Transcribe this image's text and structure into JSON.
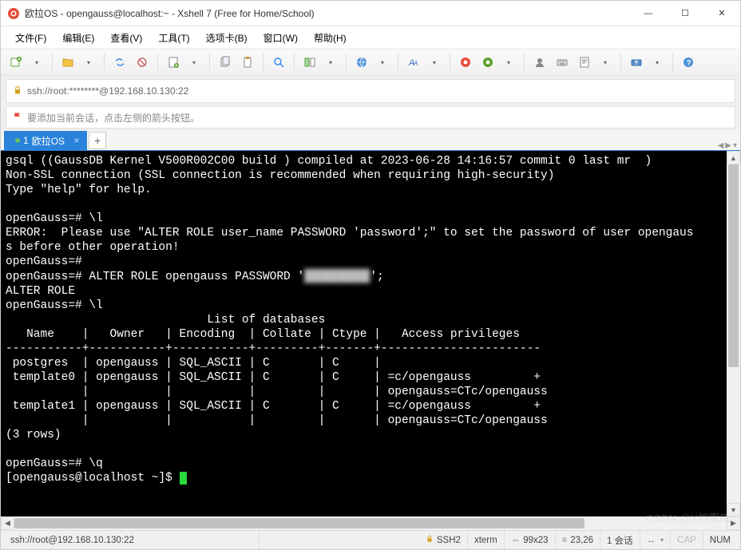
{
  "window": {
    "title": "欧拉OS - opengauss@localhost:~ - Xshell 7 (Free for Home/School)"
  },
  "menu": [
    {
      "label": "文件(F)"
    },
    {
      "label": "编辑(E)"
    },
    {
      "label": "查看(V)"
    },
    {
      "label": "工具(T)"
    },
    {
      "label": "选项卡(B)"
    },
    {
      "label": "窗口(W)"
    },
    {
      "label": "帮助(H)"
    }
  ],
  "address": {
    "value": "ssh://root:********@192.168.10.130:22"
  },
  "hint": {
    "text": "要添加当前会话，点击左侧的箭头按钮。"
  },
  "tabs": {
    "active": {
      "index": "1",
      "label": "欧拉OS"
    }
  },
  "terminal": {
    "lines": [
      "gsql ((GaussDB Kernel V500R002C00 build ) compiled at 2023-06-28 14:16:57 commit 0 last mr  )",
      "Non-SSL connection (SSL connection is recommended when requiring high-security)",
      "Type \"help\" for help.",
      "",
      "openGauss=# \\l",
      "ERROR:  Please use \"ALTER ROLE user_name PASSWORD 'password';\" to set the password of user opengaus",
      "s before other operation!",
      "openGauss=#",
      "openGauss=# ALTER ROLE opengauss PASSWORD '████████';",
      "ALTER ROLE",
      "openGauss=# \\l",
      "                             List of databases",
      "   Name    |   Owner   | Encoding  | Collate | Ctype |   Access privileges   ",
      "-----------+-----------+-----------+---------+-------+-----------------------",
      " postgres  | opengauss | SQL_ASCII | C       | C     | ",
      " template0 | opengauss | SQL_ASCII | C       | C     | =c/opengauss         +",
      "           |           |           |         |       | opengauss=CTc/opengauss",
      " template1 | opengauss | SQL_ASCII | C       | C     | =c/opengauss         +",
      "           |           |           |         |       | opengauss=CTc/opengauss",
      "(3 rows)",
      "",
      "openGauss=# \\q",
      "[opengauss@localhost ~]$ "
    ],
    "prompt_cursor": true
  },
  "status": {
    "path": "ssh://root@192.168.10.130:22",
    "protocol": "SSH2",
    "term": "xterm",
    "size": "99x23",
    "cursor": "23,26",
    "sessions": "1 会话",
    "cap": "CAP",
    "num": "NUM"
  },
  "icons": {
    "minimize": "—",
    "maximize": "☐",
    "close": "✕",
    "plus": "+",
    "tab_close": "×",
    "arrow_left": "◀",
    "arrow_right": "▶",
    "arrow_up": "▲",
    "arrow_down": "▼",
    "dropdown": "▾",
    "link": "↔"
  },
  "watermark": "CSDN @X档案库"
}
